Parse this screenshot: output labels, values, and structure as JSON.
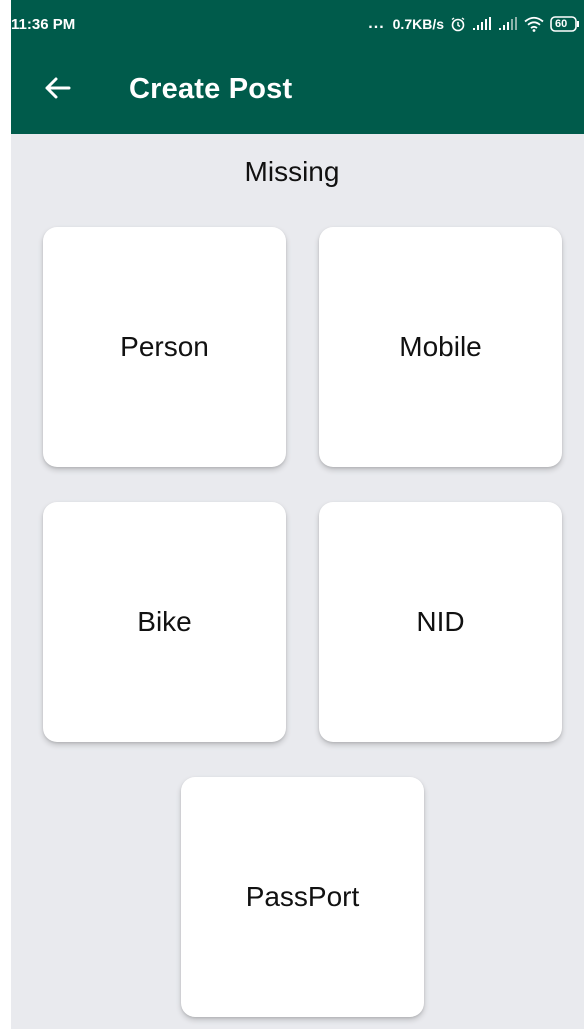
{
  "status_bar": {
    "time": "11:36 PM",
    "dots": "...",
    "network_speed": "0.7KB/s",
    "battery": "60",
    "icons": [
      "alarm-icon",
      "signal-icon",
      "signal-weak-icon",
      "wifi-icon",
      "battery-icon"
    ]
  },
  "app_bar": {
    "back_icon": "arrow-left-icon",
    "title": "Create Post"
  },
  "main": {
    "heading": "Missing",
    "categories": [
      {
        "label": "Person"
      },
      {
        "label": "Mobile"
      },
      {
        "label": "Bike"
      },
      {
        "label": "NID"
      },
      {
        "label": "PassPort"
      }
    ]
  },
  "colors": {
    "primary": "#005b4b",
    "background": "#e9eaee",
    "card": "#ffffff"
  }
}
